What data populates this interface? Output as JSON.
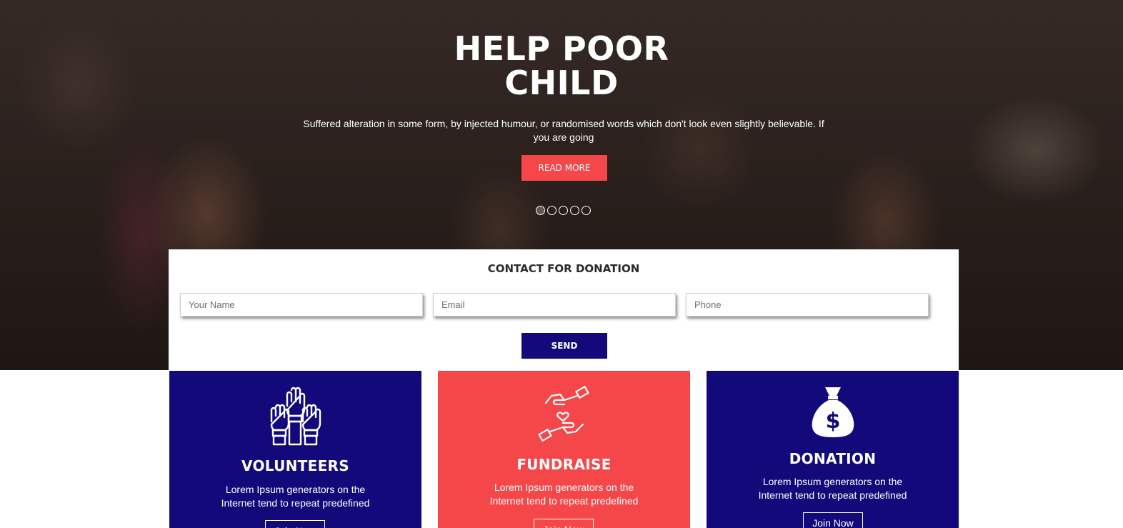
{
  "hero": {
    "title_line1": "HELP POOR",
    "title_line2": "CHILD",
    "subtitle": "Suffered alteration in some form, by injected humour, or randomised words which don't look even slightly believable. If you are going",
    "read_more_label": "READ MORE",
    "slide_count": 5,
    "active_slide": 1
  },
  "contact": {
    "title": "CONTACT FOR DONATION",
    "name_placeholder": "Your Name",
    "email_placeholder": "Email",
    "phone_placeholder": "Phone",
    "send_label": "SEND"
  },
  "cards": [
    {
      "title": "VOLUNTEERS",
      "text": "Lorem Ipsum generators on the Internet tend to repeat predefined",
      "button_label": "Join Now",
      "icon": "raised-hands-icon",
      "color": "#120a7a"
    },
    {
      "title": "FUNDRAISE",
      "text": "Lorem Ipsum generators on the Internet tend to repeat predefined",
      "button_label": "Join Now",
      "icon": "giving-hands-heart-icon",
      "color": "#f5474a"
    },
    {
      "title": "DONATION",
      "text": "Lorem Ipsum generators on the Internet tend to repeat predefined",
      "button_label": "Join Now",
      "icon": "money-bag-icon",
      "color": "#120a7a"
    }
  ],
  "colors": {
    "accent_red": "#f5474a",
    "brand_navy": "#120a7a"
  }
}
